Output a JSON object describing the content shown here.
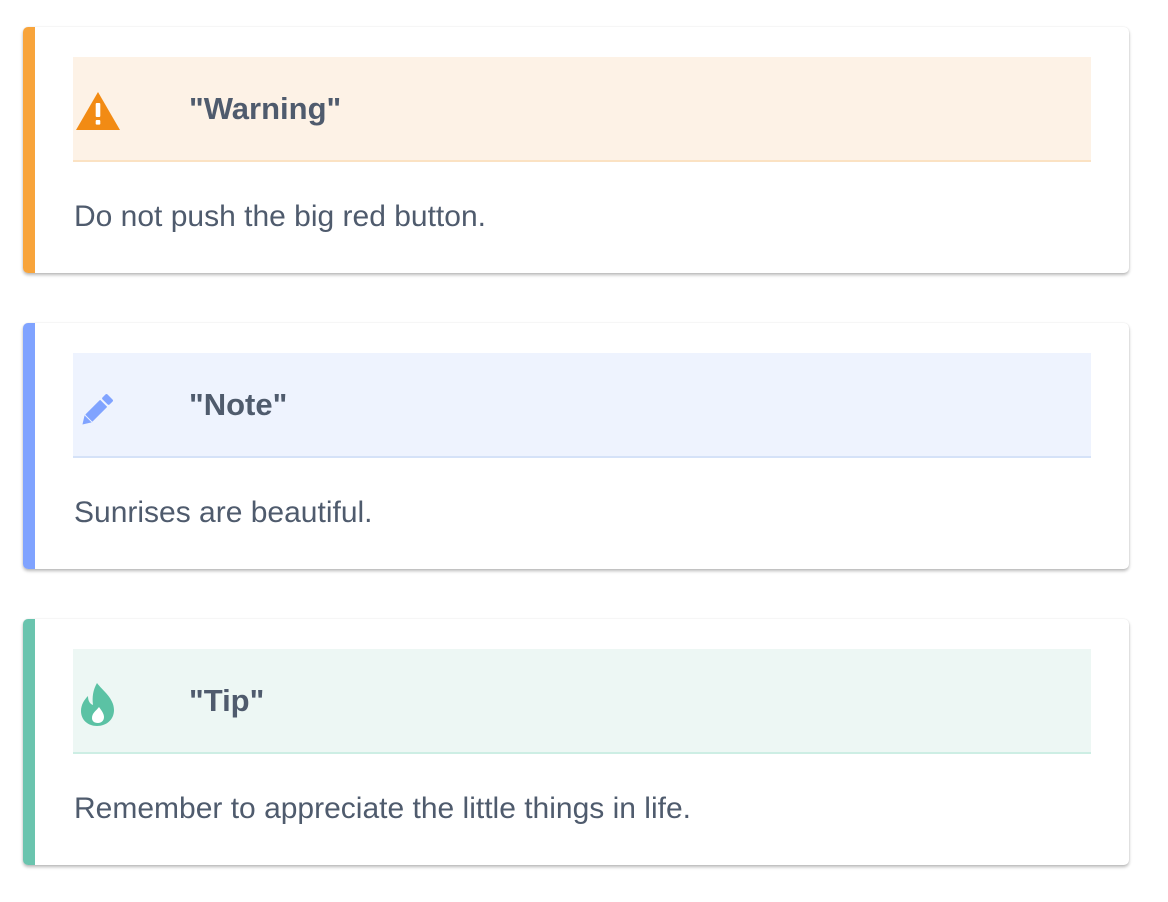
{
  "admonitions": [
    {
      "kind": "warning",
      "title": "\"Warning\"",
      "text": "Do not push the big red button.",
      "icon": "warning-triangle-icon",
      "colors": {
        "accent": "#f8a43b",
        "header_bg": "#fdf2e6",
        "header_border": "#fbe2c3",
        "icon": "#f28b14"
      }
    },
    {
      "kind": "note",
      "title": "\"Note\"",
      "text": "Sunrises are beautiful.",
      "icon": "pencil-icon",
      "colors": {
        "accent": "#80a3ff",
        "header_bg": "#eef3fe",
        "header_border": "#d5e2f8",
        "icon": "#80a3ff"
      }
    },
    {
      "kind": "tip",
      "title": "\"Tip\"",
      "text": "Remember to appreciate the little things in life.",
      "icon": "flame-icon",
      "colors": {
        "accent": "#6ac4ae",
        "header_bg": "#edf7f4",
        "header_border": "#cdeee4",
        "icon": "#5bc2a4"
      }
    }
  ]
}
